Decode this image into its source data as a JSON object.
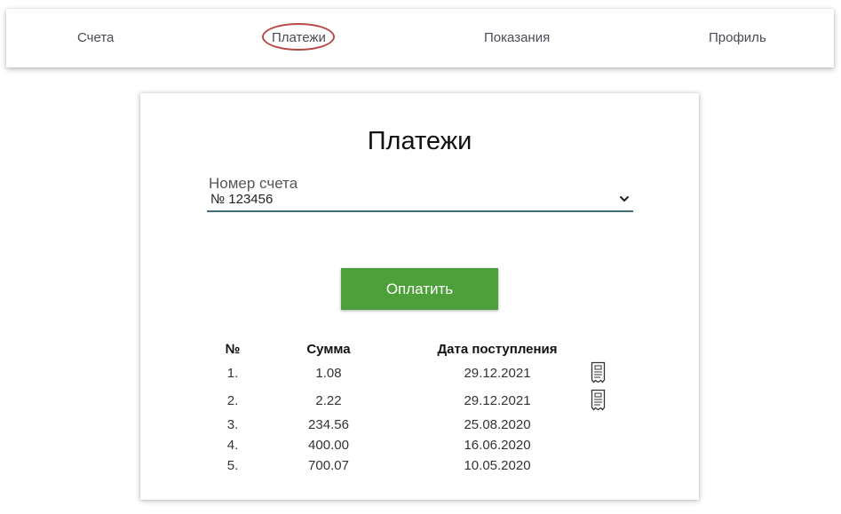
{
  "nav": {
    "items": [
      {
        "label": "Счета"
      },
      {
        "label": "Платежи",
        "active": true
      },
      {
        "label": "Показания"
      },
      {
        "label": "Профиль"
      }
    ],
    "highlight_color": "#b84a45"
  },
  "page": {
    "title": "Платежи"
  },
  "account_select": {
    "label": "Номер счета",
    "value": "№ 123456",
    "icon": "chevron-down-icon",
    "underline_color": "#3f6e83"
  },
  "pay_button": {
    "label": "Оплатить",
    "color": "#4ea13a"
  },
  "payments_table": {
    "columns": [
      "№",
      "Сумма",
      "Дата поступления"
    ],
    "rows": [
      {
        "num": "1.",
        "amount": "1.08",
        "date": "29.12.2021",
        "has_receipt": true
      },
      {
        "num": "2.",
        "amount": "2.22",
        "date": "29.12.2021",
        "has_receipt": true
      },
      {
        "num": "3.",
        "amount": "234.56",
        "date": "25.08.2020",
        "has_receipt": false
      },
      {
        "num": "4.",
        "amount": "400.00",
        "date": "16.06.2020",
        "has_receipt": false
      },
      {
        "num": "5.",
        "amount": "700.07",
        "date": "10.05.2020",
        "has_receipt": false
      }
    ],
    "receipt_icon": "receipt-icon"
  }
}
